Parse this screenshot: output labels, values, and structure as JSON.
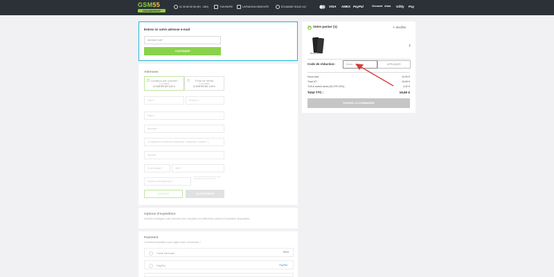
{
  "header": {
    "logo_top_a": "GSM",
    "logo_top_b": "55",
    "logo_bottom": "ONLINESHOP",
    "info": [
      {
        "text": "01 30 80 50 50 (9H - 18H)",
        "icon": "headset-icon"
      },
      {
        "text": "TVA PAYÉE",
        "icon": "receipt-icon"
      },
      {
        "text": "LIVRAISON GRATUITE",
        "icon": "truck-icon"
      },
      {
        "text": "ÉCHANGE SOUS 14J",
        "icon": "exchange-icon"
      }
    ],
    "payments": [
      "VISA",
      "AMEX",
      "PayPal",
      "Virement",
      "Alma",
      "Giftly",
      "Pay"
    ]
  },
  "email": {
    "title": "Entrez ici votre adresse e-mail",
    "placeholder": "Adresse mail*",
    "button": "CONTINUER"
  },
  "address": {
    "title": "Adresses",
    "delivery": {
      "label": "Livraison par coursier",
      "days": "1-4 Jours",
      "price": "À PARTIR DE 0,00 €"
    },
    "pickup": {
      "label": "Point de retrait",
      "days": "1-6 Jours",
      "price": "À PARTIR DE 1,99 €"
    },
    "fields": {
      "first_name": "Nom *",
      "last_name": "Prénom *",
      "country": "Pays *",
      "address": "Adresse *",
      "address_extra": "Complément d'adresse (bâtiment, entreprise, société...)",
      "company": "Société",
      "postcode": "Code postal *",
      "city": "Ville *",
      "phone": "Numéro de téléphone *",
      "phone_hint": "Nos coursiers risquent de vous contacter pour la livraison"
    },
    "cancel": "ANNULER",
    "save": "SAUVEGARDER"
  },
  "shipping": {
    "title": "Options d'expédition",
    "text": "Veuillez renseigner votre adresse pour visualiser les différentes options d'expédition disponibles"
  },
  "payment": {
    "title": "Paiement",
    "subtitle": "Comment souhaitez-vous régler votre commande ?",
    "options": [
      {
        "label": "Carte bancaire",
        "brand": "VISA"
      },
      {
        "label": "PayPal",
        "brand": "PayPal"
      }
    ]
  },
  "cart": {
    "title": "Votre panier (1)",
    "edit": "Modifier",
    "product_label": "iPhone 11",
    "code_label": "Code de réduction:",
    "code_placeholder": "Entrer...",
    "code_button": "APPLIQUER",
    "subtotal_label": "Sous-total :",
    "subtotal_value": "19,90 €",
    "ht_label": "Total HT :",
    "ht_value": "16,65 €",
    "tax_label": "TVA & autres taxes (EU-FR 20%) :",
    "tax_value": "3,32 €",
    "total_label": "Total TTC :",
    "total_value": "19,90 €",
    "pass_button": "PASSER LA COMMANDE"
  }
}
